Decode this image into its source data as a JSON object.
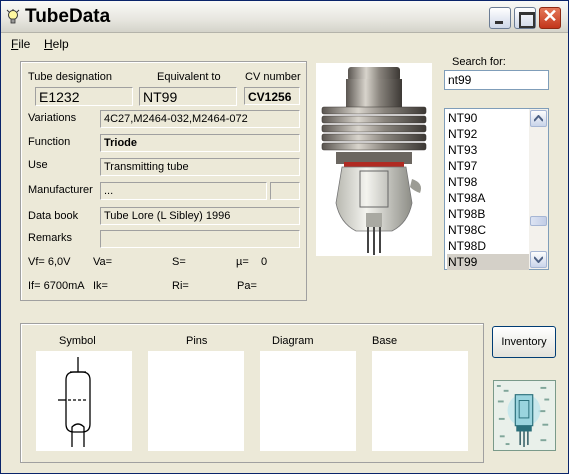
{
  "window": {
    "title": "TubeData"
  },
  "menu": {
    "file": "File",
    "help": "Help"
  },
  "info": {
    "designation_label": "Tube designation",
    "designation": "E1232",
    "equivalent_label": "Equivalent to",
    "equivalent": "NT99",
    "cv_label": "CV number",
    "cv": "CV1256",
    "variations_label": "Variations",
    "variations": "4C27,M2464-032,M2464-072",
    "function_label": "Function",
    "function": "Triode",
    "use_label": "Use",
    "use": "Transmitting tube",
    "manufacturer_label": "Manufacturer",
    "manufacturer": "...",
    "databook_label": "Data book",
    "databook": "Tube Lore (L Sibley) 1996",
    "remarks_label": "Remarks",
    "remarks": "",
    "vf": "Vf= 6,0V",
    "va": "Va=",
    "s": "S=",
    "mu": "µ=",
    "mu_value": "0",
    "if": "If= 6700mA",
    "ik": "Ik=",
    "ri": "Ri=",
    "pa": "Pa="
  },
  "search": {
    "label": "Search for:",
    "value": "nt99"
  },
  "list": {
    "items": [
      "NT90",
      "NT92",
      "NT93",
      "NT97",
      "NT98",
      "NT98A",
      "NT98B",
      "NT98C",
      "NT98D",
      "NT99"
    ],
    "selected": "NT99"
  },
  "bottom": {
    "symbol": "Symbol",
    "pins": "Pins",
    "diagram": "Diagram",
    "base": "Base",
    "inventory": "Inventory"
  },
  "icons": [
    "lightbulb-icon",
    "minimize-icon",
    "maximize-icon",
    "close-icon",
    "scroll-up-icon",
    "scroll-down-icon",
    "triode-symbol-icon"
  ],
  "colors": {
    "selection": "#d4d0c8",
    "close_button": "#c2351b",
    "window_bg": "#ece9d8"
  }
}
